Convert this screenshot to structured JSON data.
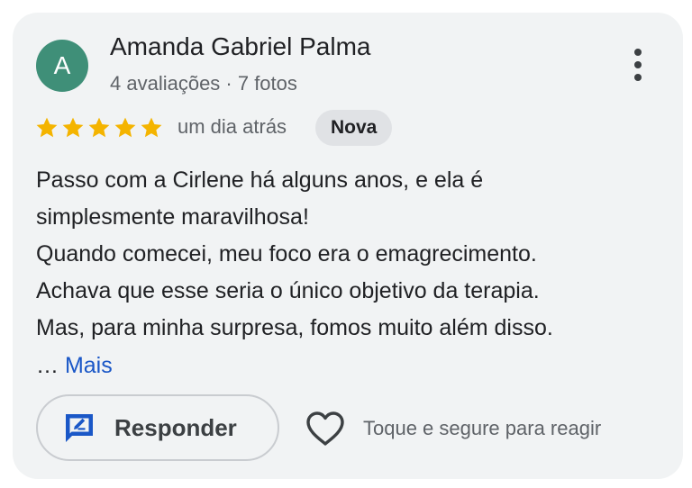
{
  "review": {
    "author_name": "Amanda Gabriel Palma",
    "avatar_letter": "A",
    "author_meta": "4 avaliações · 7 fotos",
    "rating": 5,
    "rating_max": 5,
    "date": "um dia atrás",
    "badge": "Nova",
    "text_lines": [
      "Passo com a Cirlene há alguns anos, e ela é",
      "simplesmente maravilhosa!",
      "Quando comecei, meu foco era o emagrecimento.",
      "Achava que esse seria o único objetivo da terapia.",
      "Mas, para minha surpresa, fomos muito além disso."
    ],
    "ellipsis": "…",
    "more_label": "Mais"
  },
  "actions": {
    "reply_label": "Responder",
    "reply_icon": "reply-edit-icon",
    "react_icon": "heart-outline-icon",
    "react_hint": "Toque e segure para reagir",
    "menu_icon": "more-vert-icon"
  },
  "colors": {
    "card_background": "#f1f3f4",
    "avatar": "#3f8f78",
    "star": "#f4b400",
    "link": "#1a57c7",
    "reply_icon": "#1a57c7",
    "badge_background": "#e0e2e5"
  }
}
